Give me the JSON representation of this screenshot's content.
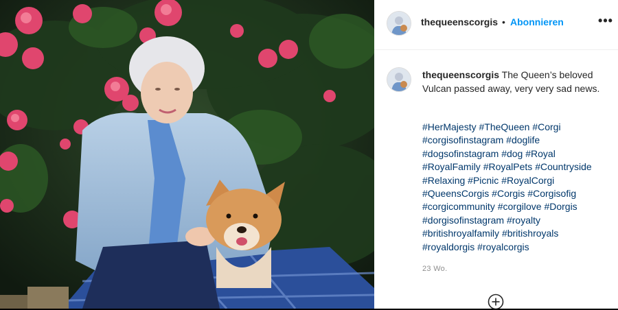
{
  "post": {
    "username": "thequeenscorgis",
    "separator": "•",
    "follow_label": "Abonnieren",
    "more_label": "•••",
    "caption_user": "thequeenscorgis",
    "caption_text": " The Queen’s beloved Vulcan passed away, very very sad news.",
    "hashtags": [
      "#HerMajesty",
      "#TheQueen",
      "#Corgi",
      "#corgisofinstagram",
      "#doglife",
      "#dogsofinstagram",
      "#dog",
      "#Royal",
      "#RoyalFamily",
      "#RoyalPets",
      "#Countryside",
      "#Relaxing",
      "#Picnic",
      "#RoyalCorgi",
      "#QueensCorgis",
      "#Corgis",
      "#Corgisofig",
      "#corgicommunity",
      "#corgilove",
      "#Dorgis",
      "#dorgisofinstagram",
      "#royalty",
      "#britishroyalfamily",
      "#britishroyals",
      "#royaldorgis",
      "#royalcorgis"
    ],
    "timestamp": "23 Wo."
  },
  "icons": {
    "more": "more-options-icon",
    "add_comment": "add-circle-icon",
    "profile": "avatar"
  },
  "colors": {
    "link_blue": "#0095f6",
    "hashtag_blue": "#00376b",
    "muted": "#8e8e8e"
  }
}
